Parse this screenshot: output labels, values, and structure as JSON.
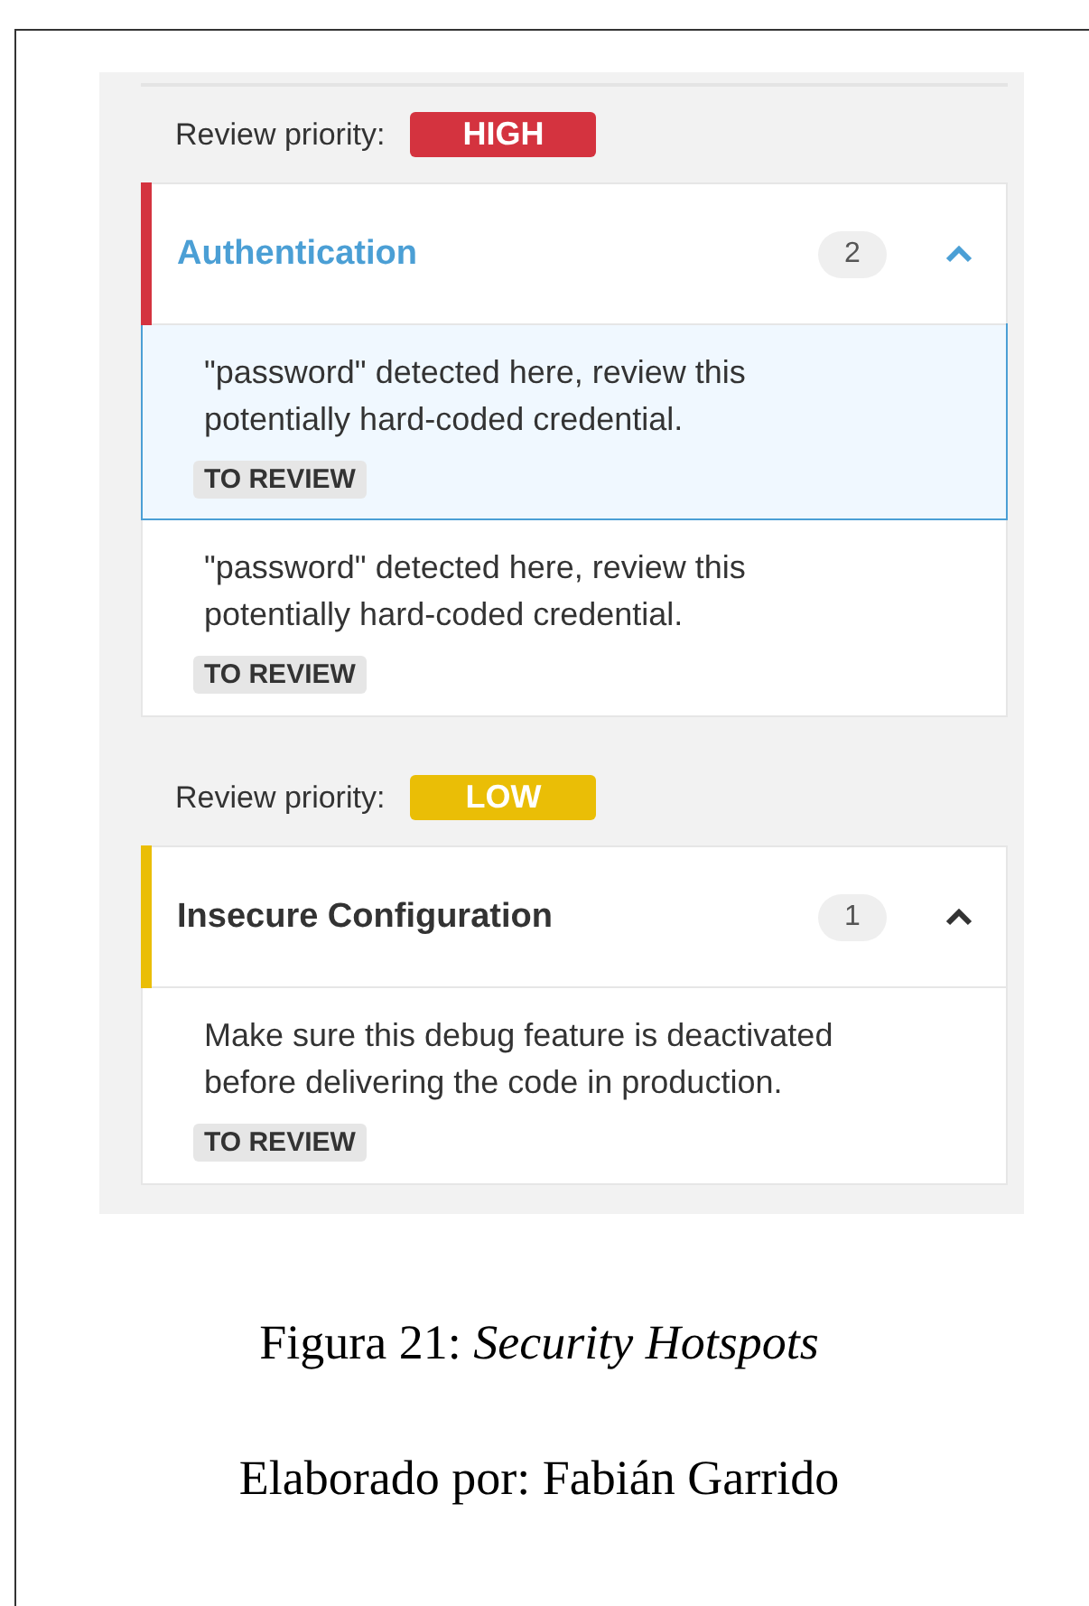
{
  "groups": [
    {
      "priority_label": "Review priority:",
      "priority": "HIGH",
      "color": "#d4333f",
      "category": {
        "title": "Authentication",
        "count": "2",
        "selected": true,
        "expanded": true
      },
      "hotspots": [
        {
          "message": "\"password\" detected here, review this potentially hard-coded credential.",
          "status": "TO REVIEW",
          "selected": true
        },
        {
          "message": "\"password\" detected here, review this potentially hard-coded credential.",
          "status": "TO REVIEW",
          "selected": false
        }
      ]
    },
    {
      "priority_label": "Review priority:",
      "priority": "LOW",
      "color": "#eabe06",
      "category": {
        "title": "Insecure Configuration",
        "count": "1",
        "selected": false,
        "expanded": true
      },
      "hotspots": [
        {
          "message": "Make sure this debug feature is deactivated before delivering the code in production.",
          "status": "TO REVIEW",
          "selected": false
        }
      ]
    }
  ],
  "caption": "Figura 21: *Security Hotspots*",
  "credit": "Elaborado por: Fabián Garrido"
}
